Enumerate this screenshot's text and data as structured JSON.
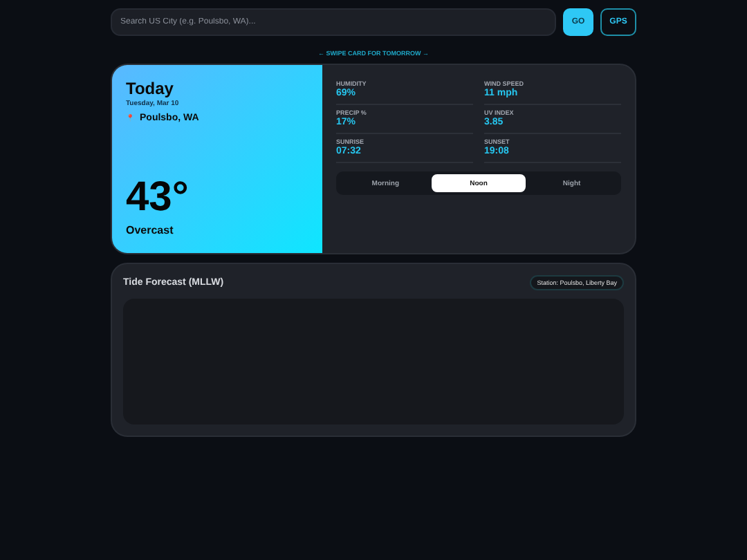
{
  "search": {
    "placeholder": "Search US City (e.g. Poulsbo, WA)..."
  },
  "buttons": [
    {
      "kind": "primary",
      "label": "GO"
    },
    {
      "kind": "outline",
      "label": "GPS"
    }
  ],
  "swipe_hint": "← SWIPE CARD FOR TOMORROW →",
  "today": {
    "title": "Today",
    "date": "Tuesday, Mar 10",
    "pin": "📍",
    "location": "Poulsbo, WA",
    "temperature": "43°",
    "condition": "Overcast"
  },
  "stats": [
    {
      "label": "HUMIDITY",
      "value": "69%"
    },
    {
      "label": "WIND SPEED",
      "value": "11 mph"
    },
    {
      "label": "PRECIP %",
      "value": "17%"
    },
    {
      "label": "UV INDEX",
      "value": "3.85"
    },
    {
      "label": "SUNRISE",
      "value": "07:32"
    },
    {
      "label": "SUNSET",
      "value": "19:08"
    }
  ],
  "periods": [
    {
      "label": "Morning",
      "selected": false
    },
    {
      "label": "Noon",
      "selected": true
    },
    {
      "label": "Night",
      "selected": false
    }
  ],
  "tide": {
    "title": "Tide Forecast (MLLW)",
    "station": "Station: Poulsbo, Liberty Bay"
  }
}
